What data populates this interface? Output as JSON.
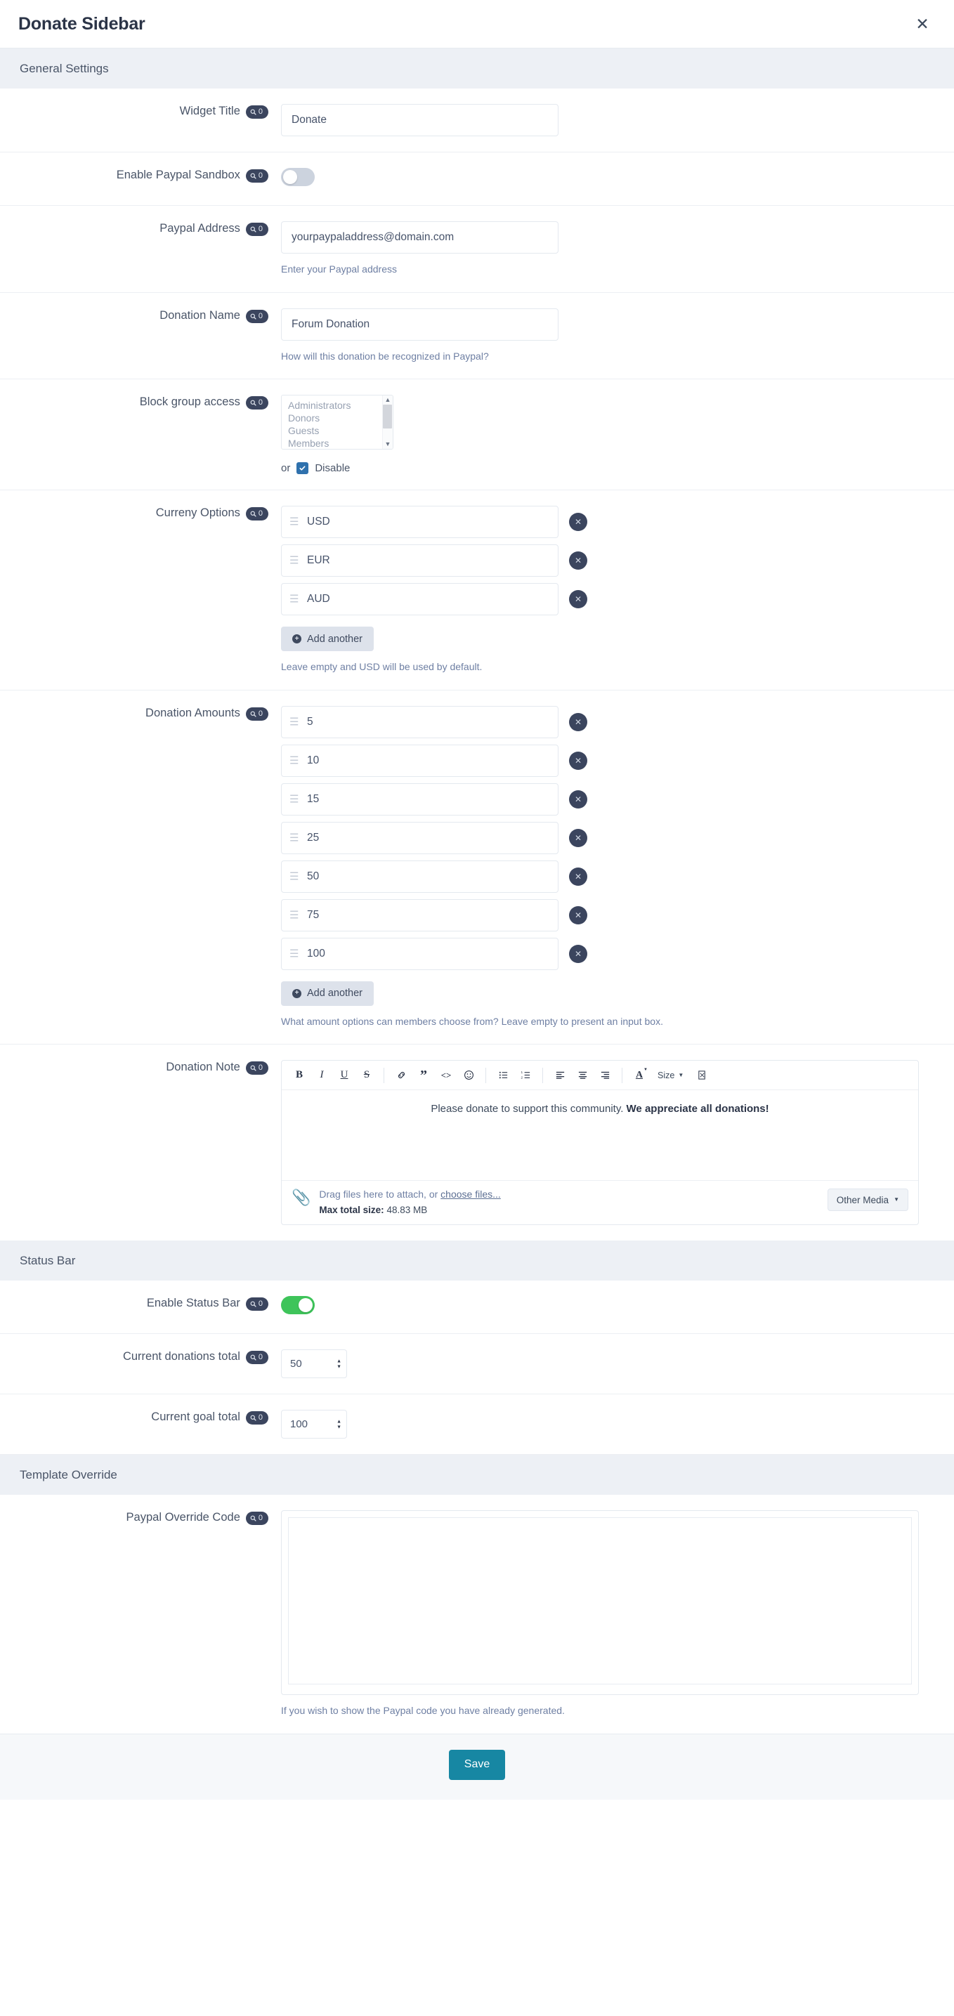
{
  "header": {
    "title": "Donate Sidebar",
    "close_label": "✕"
  },
  "badge": {
    "count": "0"
  },
  "sections": {
    "general": {
      "title": "General Settings"
    },
    "status_bar": {
      "title": "Status Bar"
    },
    "template_override": {
      "title": "Template Override"
    }
  },
  "fields": {
    "widget_title": {
      "label": "Widget Title",
      "value": "Donate"
    },
    "enable_paypal_sandbox": {
      "label": "Enable Paypal Sandbox",
      "state": "off"
    },
    "paypal_address": {
      "label": "Paypal Address",
      "value": "yourpaypaladdress@domain.com",
      "help": "Enter your Paypal address"
    },
    "donation_name": {
      "label": "Donation Name",
      "value": "Forum Donation",
      "help": "How will this donation be recognized in Paypal?"
    },
    "block_group_access": {
      "label": "Block group access",
      "options": [
        "Administrators",
        "Donors",
        "Guests",
        "Members"
      ],
      "or_text": "or",
      "disable_label": "Disable",
      "disable_checked": true
    },
    "currency_options": {
      "label": "Curreny Options",
      "values": [
        "USD",
        "EUR",
        "AUD"
      ],
      "add_label": "Add another",
      "help": "Leave empty and USD will be used by default."
    },
    "donation_amounts": {
      "label": "Donation Amounts",
      "values": [
        "5",
        "10",
        "15",
        "25",
        "50",
        "75",
        "100"
      ],
      "add_label": "Add another",
      "help": "What amount options can members choose from? Leave empty to present an input box."
    },
    "donation_note": {
      "label": "Donation Note",
      "content_plain": "Please donate to support this community. ",
      "content_bold": "We appreciate all donations!",
      "toolbar": {
        "bold": "B",
        "italic": "I",
        "underline": "U",
        "strikethrough": "S",
        "link": "🔗",
        "quote": "”",
        "code": "<>",
        "emoji": "☺",
        "bullet_list": "•≡",
        "numbered_list": "1≡",
        "align_left": "≡",
        "align_center": "≡",
        "align_right": "≡",
        "text_color": "A",
        "size_label": "Size",
        "source": "ⓡ"
      },
      "attach": {
        "drag_text": "Drag files here to attach, or ",
        "choose_link": "choose files...",
        "max_label": "Max total size:",
        "max_value": " 48.83 MB",
        "other_media": "Other Media"
      }
    },
    "enable_status_bar": {
      "label": "Enable Status Bar",
      "state": "on"
    },
    "current_donations_total": {
      "label": "Current donations total",
      "value": "50"
    },
    "current_goal_total": {
      "label": "Current goal total",
      "value": "100"
    },
    "paypal_override_code": {
      "label": "Paypal Override Code",
      "value": "",
      "help": "If you wish to show the Paypal code you have already generated."
    }
  },
  "footer": {
    "save_label": "Save"
  },
  "colors": {
    "badge_bg": "#3b455e",
    "toggle_on": "#3ec45a",
    "save_bg": "#1787a3",
    "section_bg": "#edf0f5",
    "checkbox_bg": "#2f71ad"
  }
}
